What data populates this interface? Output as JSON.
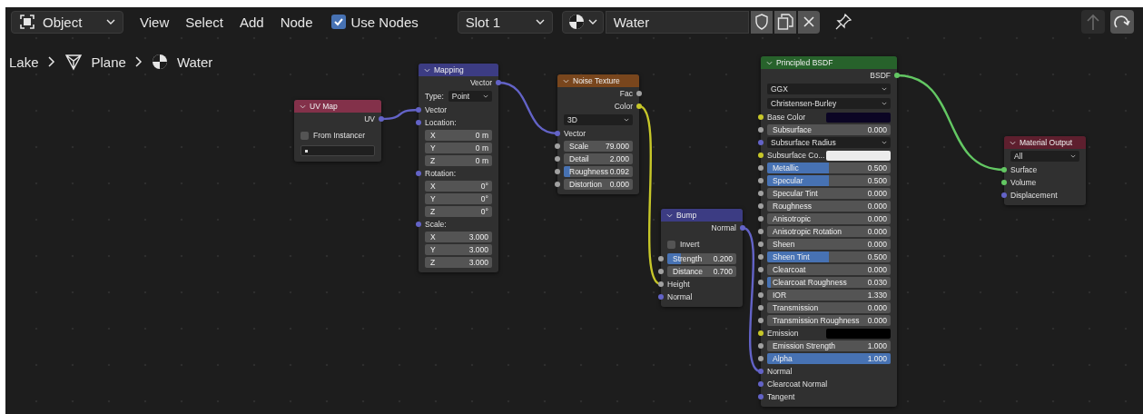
{
  "header": {
    "mode": "Object",
    "menus": [
      "View",
      "Select",
      "Add",
      "Node"
    ],
    "use_nodes": {
      "label": "Use Nodes",
      "checked": true
    },
    "slot": "Slot 1",
    "material": "Water"
  },
  "breadcrumb": [
    {
      "kind": "plain",
      "label": "Lake"
    },
    {
      "kind": "mesh",
      "label": "Plane"
    },
    {
      "kind": "material",
      "label": "Water"
    }
  ],
  "nodes": [
    {
      "title": "UV Map",
      "color": "#83314a",
      "rows": [
        {
          "kind": "output",
          "label": "UV",
          "color": "#6363c7"
        },
        {
          "kind": "check",
          "label": "From Instancer",
          "checked": false
        },
        {
          "kind": "text"
        }
      ]
    },
    {
      "title": "Mapping",
      "color": "#3c3c83",
      "rows": [
        {
          "kind": "output",
          "label": "Vector",
          "color": "#6363c7"
        },
        {
          "kind": "select",
          "label": "Type:",
          "value": "Point"
        },
        {
          "kind": "input",
          "label": "Vector",
          "color": "#6363c7"
        },
        {
          "kind": "input",
          "label": "Location:",
          "color": "#6363c7"
        },
        {
          "kind": "number",
          "label": "X",
          "value": "0 m"
        },
        {
          "kind": "number",
          "label": "Y",
          "value": "0 m"
        },
        {
          "kind": "number",
          "label": "Z",
          "value": "0 m"
        },
        {
          "kind": "input",
          "label": "Rotation:",
          "color": "#6363c7"
        },
        {
          "kind": "number",
          "label": "X",
          "value": "0°"
        },
        {
          "kind": "number",
          "label": "Y",
          "value": "0°"
        },
        {
          "kind": "number",
          "label": "Z",
          "value": "0°"
        },
        {
          "kind": "input",
          "label": "Scale:",
          "color": "#6363c7"
        },
        {
          "kind": "number",
          "label": "X",
          "value": "3.000"
        },
        {
          "kind": "number",
          "label": "Y",
          "value": "3.000"
        },
        {
          "kind": "number",
          "label": "Z",
          "value": "3.000"
        }
      ]
    },
    {
      "title": "Noise Texture",
      "color": "#79461d",
      "rows": [
        {
          "kind": "output",
          "label": "Fac",
          "color": "#a1a1a1"
        },
        {
          "kind": "output",
          "label": "Color",
          "color": "#c7c729"
        },
        {
          "kind": "select",
          "value": "3D"
        },
        {
          "kind": "input",
          "label": "Vector",
          "color": "#6363c7"
        },
        {
          "kind": "number",
          "label": "Scale",
          "value": "79.000",
          "color": "#a1a1a1"
        },
        {
          "kind": "number",
          "label": "Detail",
          "value": "2.000",
          "color": "#a1a1a1"
        },
        {
          "kind": "slider",
          "label": "Roughness",
          "value": "0.092",
          "level": 0.092,
          "color": "#a1a1a1"
        },
        {
          "kind": "number",
          "label": "Distortion",
          "value": "0.000",
          "color": "#a1a1a1"
        }
      ]
    },
    {
      "title": "Bump",
      "color": "#3c3c83",
      "rows": [
        {
          "kind": "output",
          "label": "Normal",
          "color": "#6363c7"
        },
        {
          "kind": "check",
          "label": "Invert",
          "checked": false
        },
        {
          "kind": "slider",
          "label": "Strength",
          "value": "0.200",
          "level": 0.2,
          "color": "#a1a1a1"
        },
        {
          "kind": "number",
          "label": "Distance",
          "value": "0.700",
          "color": "#a1a1a1"
        },
        {
          "kind": "input",
          "label": "Height",
          "color": "#a1a1a1"
        },
        {
          "kind": "input",
          "label": "Normal",
          "color": "#6363c7"
        }
      ]
    },
    {
      "title": "Principled BSDF",
      "color": "#27622b",
      "rows": [
        {
          "kind": "output",
          "label": "BSDF",
          "color": "#63c763"
        },
        {
          "kind": "select",
          "value": "GGX"
        },
        {
          "kind": "select",
          "value": "Christensen-Burley"
        },
        {
          "kind": "swatch",
          "label": "Base Color",
          "swatch": {
            "color": "#0b0524"
          },
          "color": "#c7c729"
        },
        {
          "kind": "number",
          "label": "Subsurface",
          "value": "0.000",
          "color": "#a1a1a1"
        },
        {
          "kind": "select",
          "value": "Subsurface Radius",
          "color": "#6363c7"
        },
        {
          "kind": "swatch",
          "label": "Subsurface Co...",
          "swatch": {
            "color": "#ececec"
          },
          "color": "#c7c729"
        },
        {
          "kind": "slider",
          "label": "Metallic",
          "value": "0.500",
          "level": 0.5,
          "color": "#a1a1a1"
        },
        {
          "kind": "slider",
          "label": "Specular",
          "value": "0.500",
          "level": 0.5,
          "color": "#a1a1a1"
        },
        {
          "kind": "number",
          "label": "Specular Tint",
          "value": "0.000",
          "color": "#a1a1a1"
        },
        {
          "kind": "number",
          "label": "Roughness",
          "value": "0.000",
          "color": "#a1a1a1"
        },
        {
          "kind": "number",
          "label": "Anisotropic",
          "value": "0.000",
          "color": "#a1a1a1"
        },
        {
          "kind": "number",
          "label": "Anisotropic Rotation",
          "value": "0.000",
          "color": "#a1a1a1"
        },
        {
          "kind": "number",
          "label": "Sheen",
          "value": "0.000",
          "color": "#a1a1a1"
        },
        {
          "kind": "slider",
          "label": "Sheen Tint",
          "value": "0.500",
          "level": 0.5,
          "color": "#a1a1a1"
        },
        {
          "kind": "number",
          "label": "Clearcoat",
          "value": "0.000",
          "color": "#a1a1a1"
        },
        {
          "kind": "slider",
          "label": "Clearcoat Roughness",
          "value": "0.030",
          "level": 0.03,
          "color": "#a1a1a1"
        },
        {
          "kind": "number",
          "label": "IOR",
          "value": "1.330",
          "color": "#a1a1a1"
        },
        {
          "kind": "number",
          "label": "Transmission",
          "value": "0.000",
          "color": "#a1a1a1"
        },
        {
          "kind": "number",
          "label": "Transmission Roughness",
          "value": "0.000",
          "color": "#a1a1a1"
        },
        {
          "kind": "swatch",
          "label": "Emission",
          "swatch": {
            "color": "#000000"
          },
          "color": "#c7c729"
        },
        {
          "kind": "number",
          "label": "Emission Strength",
          "value": "1.000",
          "color": "#a1a1a1"
        },
        {
          "kind": "slider",
          "label": "Alpha",
          "value": "1.000",
          "level": 1,
          "color": "#a1a1a1"
        },
        {
          "kind": "input",
          "label": "Normal",
          "color": "#6363c7"
        },
        {
          "kind": "input",
          "label": "Clearcoat Normal",
          "color": "#6363c7"
        },
        {
          "kind": "input",
          "label": "Tangent",
          "color": "#6363c7"
        }
      ]
    },
    {
      "title": "Material Output",
      "color": "#5e1f2e",
      "rows": [
        {
          "kind": "select",
          "value": "All"
        },
        {
          "kind": "input",
          "label": "Surface",
          "color": "#63c763"
        },
        {
          "kind": "input",
          "label": "Volume",
          "color": "#63c763"
        },
        {
          "kind": "input",
          "label": "Displacement",
          "color": "#6363c7"
        }
      ]
    }
  ]
}
